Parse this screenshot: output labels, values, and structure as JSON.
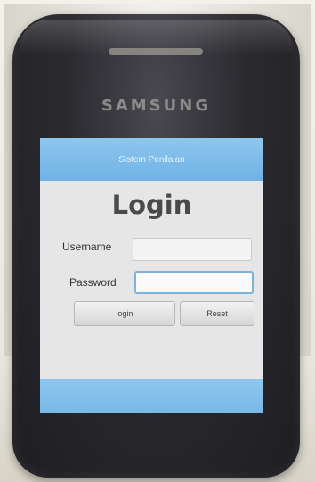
{
  "phone": {
    "brand": "SAMSUNG"
  },
  "app": {
    "header_title": "Sistem Penilaian",
    "page_title": "Login",
    "username_label": "Username",
    "username_value": "",
    "password_label": "Password",
    "password_value": "",
    "login_button": "login",
    "reset_button": "Reset",
    "footer_text": "",
    "colors": {
      "header_blue": "#7ab8e8",
      "screen_bg": "#e6e6e6",
      "phone_body": "#24242a"
    }
  }
}
